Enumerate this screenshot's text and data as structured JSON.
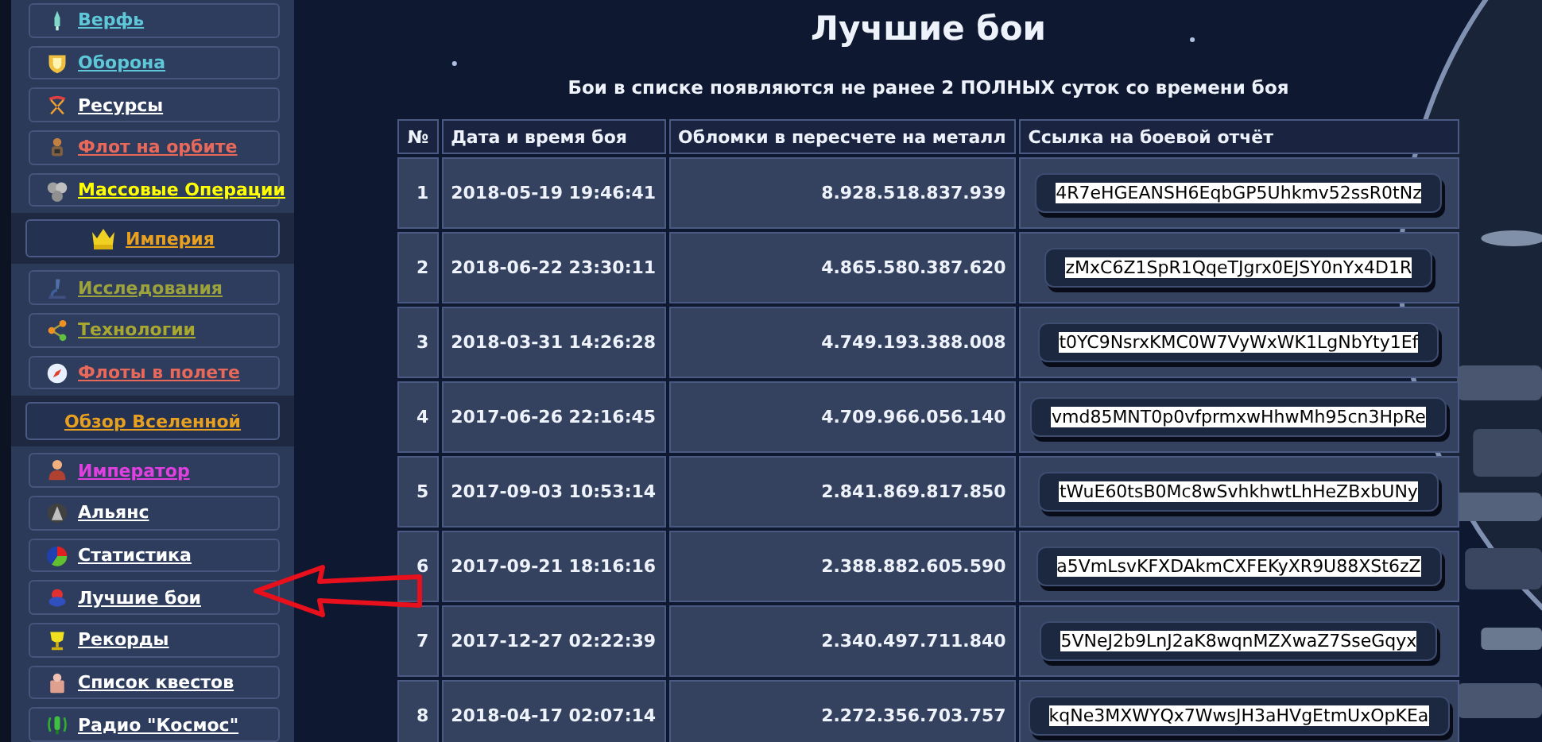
{
  "sidebar": {
    "items": [
      {
        "kind": "link",
        "label": "Верфь",
        "color": "#5ec8d8"
      },
      {
        "kind": "link",
        "label": "Оборона",
        "color": "#5ec8d8"
      },
      {
        "kind": "link",
        "label": "Ресурсы",
        "color": "#ffffff"
      },
      {
        "kind": "link",
        "label": "Флот на орбите",
        "color": "#e8685a"
      },
      {
        "kind": "link",
        "label": "Массовые Операции",
        "color": "#ffff00"
      },
      {
        "kind": "section",
        "label": "Империя",
        "color": "#e8a020"
      },
      {
        "kind": "link",
        "label": "Исследования",
        "color": "#9ca33c"
      },
      {
        "kind": "link",
        "label": "Технологии",
        "color": "#a8a830"
      },
      {
        "kind": "link",
        "label": "Флоты в полете",
        "color": "#e8685a"
      },
      {
        "kind": "section",
        "label": "Обзор Вселенной",
        "color": "#e8a020"
      },
      {
        "kind": "link",
        "label": "Император",
        "color": "#e040e0"
      },
      {
        "kind": "link",
        "label": "Альянс",
        "color": "#ffffff"
      },
      {
        "kind": "link",
        "label": "Статистика",
        "color": "#ffffff"
      },
      {
        "kind": "link",
        "label": "Лучшие бои",
        "color": "#ffffff"
      },
      {
        "kind": "link",
        "label": "Рекорды",
        "color": "#ffffff"
      },
      {
        "kind": "link",
        "label": "Список квестов",
        "color": "#ffffff"
      },
      {
        "kind": "link",
        "label": "Радио \"Космос\"",
        "color": "#ffffff"
      }
    ]
  },
  "main": {
    "title": "Лучшие бои",
    "subtitle": "Бои в списке появляются не ранее 2 ПОЛНЫХ суток со времени боя",
    "table": {
      "columns": [
        "№",
        "Дата и время боя",
        "Обломки в пересчете на металл",
        "Ссылка на боевой отчёт"
      ],
      "rows": [
        {
          "number": "1",
          "date": "2018-05-19 19:46:41",
          "debris": "8.928.518.837.939",
          "report": "4R7eHGEANSH6EqbGP5Uhkmv52ssR0tNz"
        },
        {
          "number": "2",
          "date": "2018-06-22 23:30:11",
          "debris": "4.865.580.387.620",
          "report": "zMxC6Z1SpR1QqeTJgrx0EJSY0nYx4D1R"
        },
        {
          "number": "3",
          "date": "2018-03-31 14:26:28",
          "debris": "4.749.193.388.008",
          "report": "t0YC9NsrxKMC0W7VyWxWK1LgNbYty1Ef"
        },
        {
          "number": "4",
          "date": "2017-06-26 22:16:45",
          "debris": "4.709.966.056.140",
          "report": "vmd85MNT0p0vfprmxwHhwMh95cn3HpRe"
        },
        {
          "number": "5",
          "date": "2017-09-03 10:53:14",
          "debris": "2.841.869.817.850",
          "report": "tWuE60tsB0Mc8wSvhkhwtLhHeZBxbUNy"
        },
        {
          "number": "6",
          "date": "2017-09-21 18:16:16",
          "debris": "2.388.882.605.590",
          "report": "a5VmLsvKFXDAkmCXFEKyXR9U88XSt6zZ"
        },
        {
          "number": "7",
          "date": "2017-12-27 02:22:39",
          "debris": "2.340.497.711.840",
          "report": "5VNeJ2b9LnJ2aK8wqnMZXwaZ7SseGqyx"
        },
        {
          "number": "8",
          "date": "2018-04-17 02:07:14",
          "debris": "2.272.356.703.757",
          "report": "kqNe3MXWYQx7WwsJH3aHVgEtmUxOpKEa"
        }
      ]
    }
  }
}
